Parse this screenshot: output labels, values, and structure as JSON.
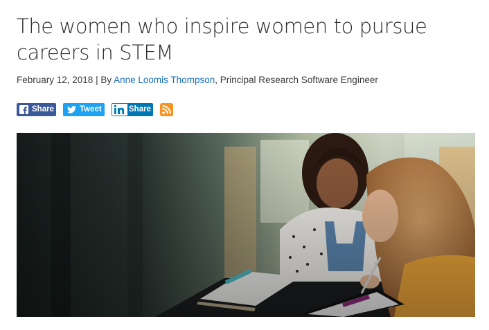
{
  "article": {
    "title": "The women who inspire women to pursue careers in STEM",
    "date": "February 12, 2018",
    "by_prefix": "| By",
    "author": "Anne Loomis Thompson",
    "author_role": ", Principal Research Software Engineer"
  },
  "share": {
    "facebook_label": "Share",
    "twitter_label": "Tweet",
    "linkedin_label": "Share",
    "icons": [
      "facebook-icon",
      "twitter-icon",
      "linkedin-icon",
      "rss-icon"
    ]
  },
  "colors": {
    "facebook": "#3b5998",
    "twitter": "#1da1f2",
    "linkedin": "#0077b5",
    "rss": "#f7931e",
    "link": "#1a6fbf"
  }
}
